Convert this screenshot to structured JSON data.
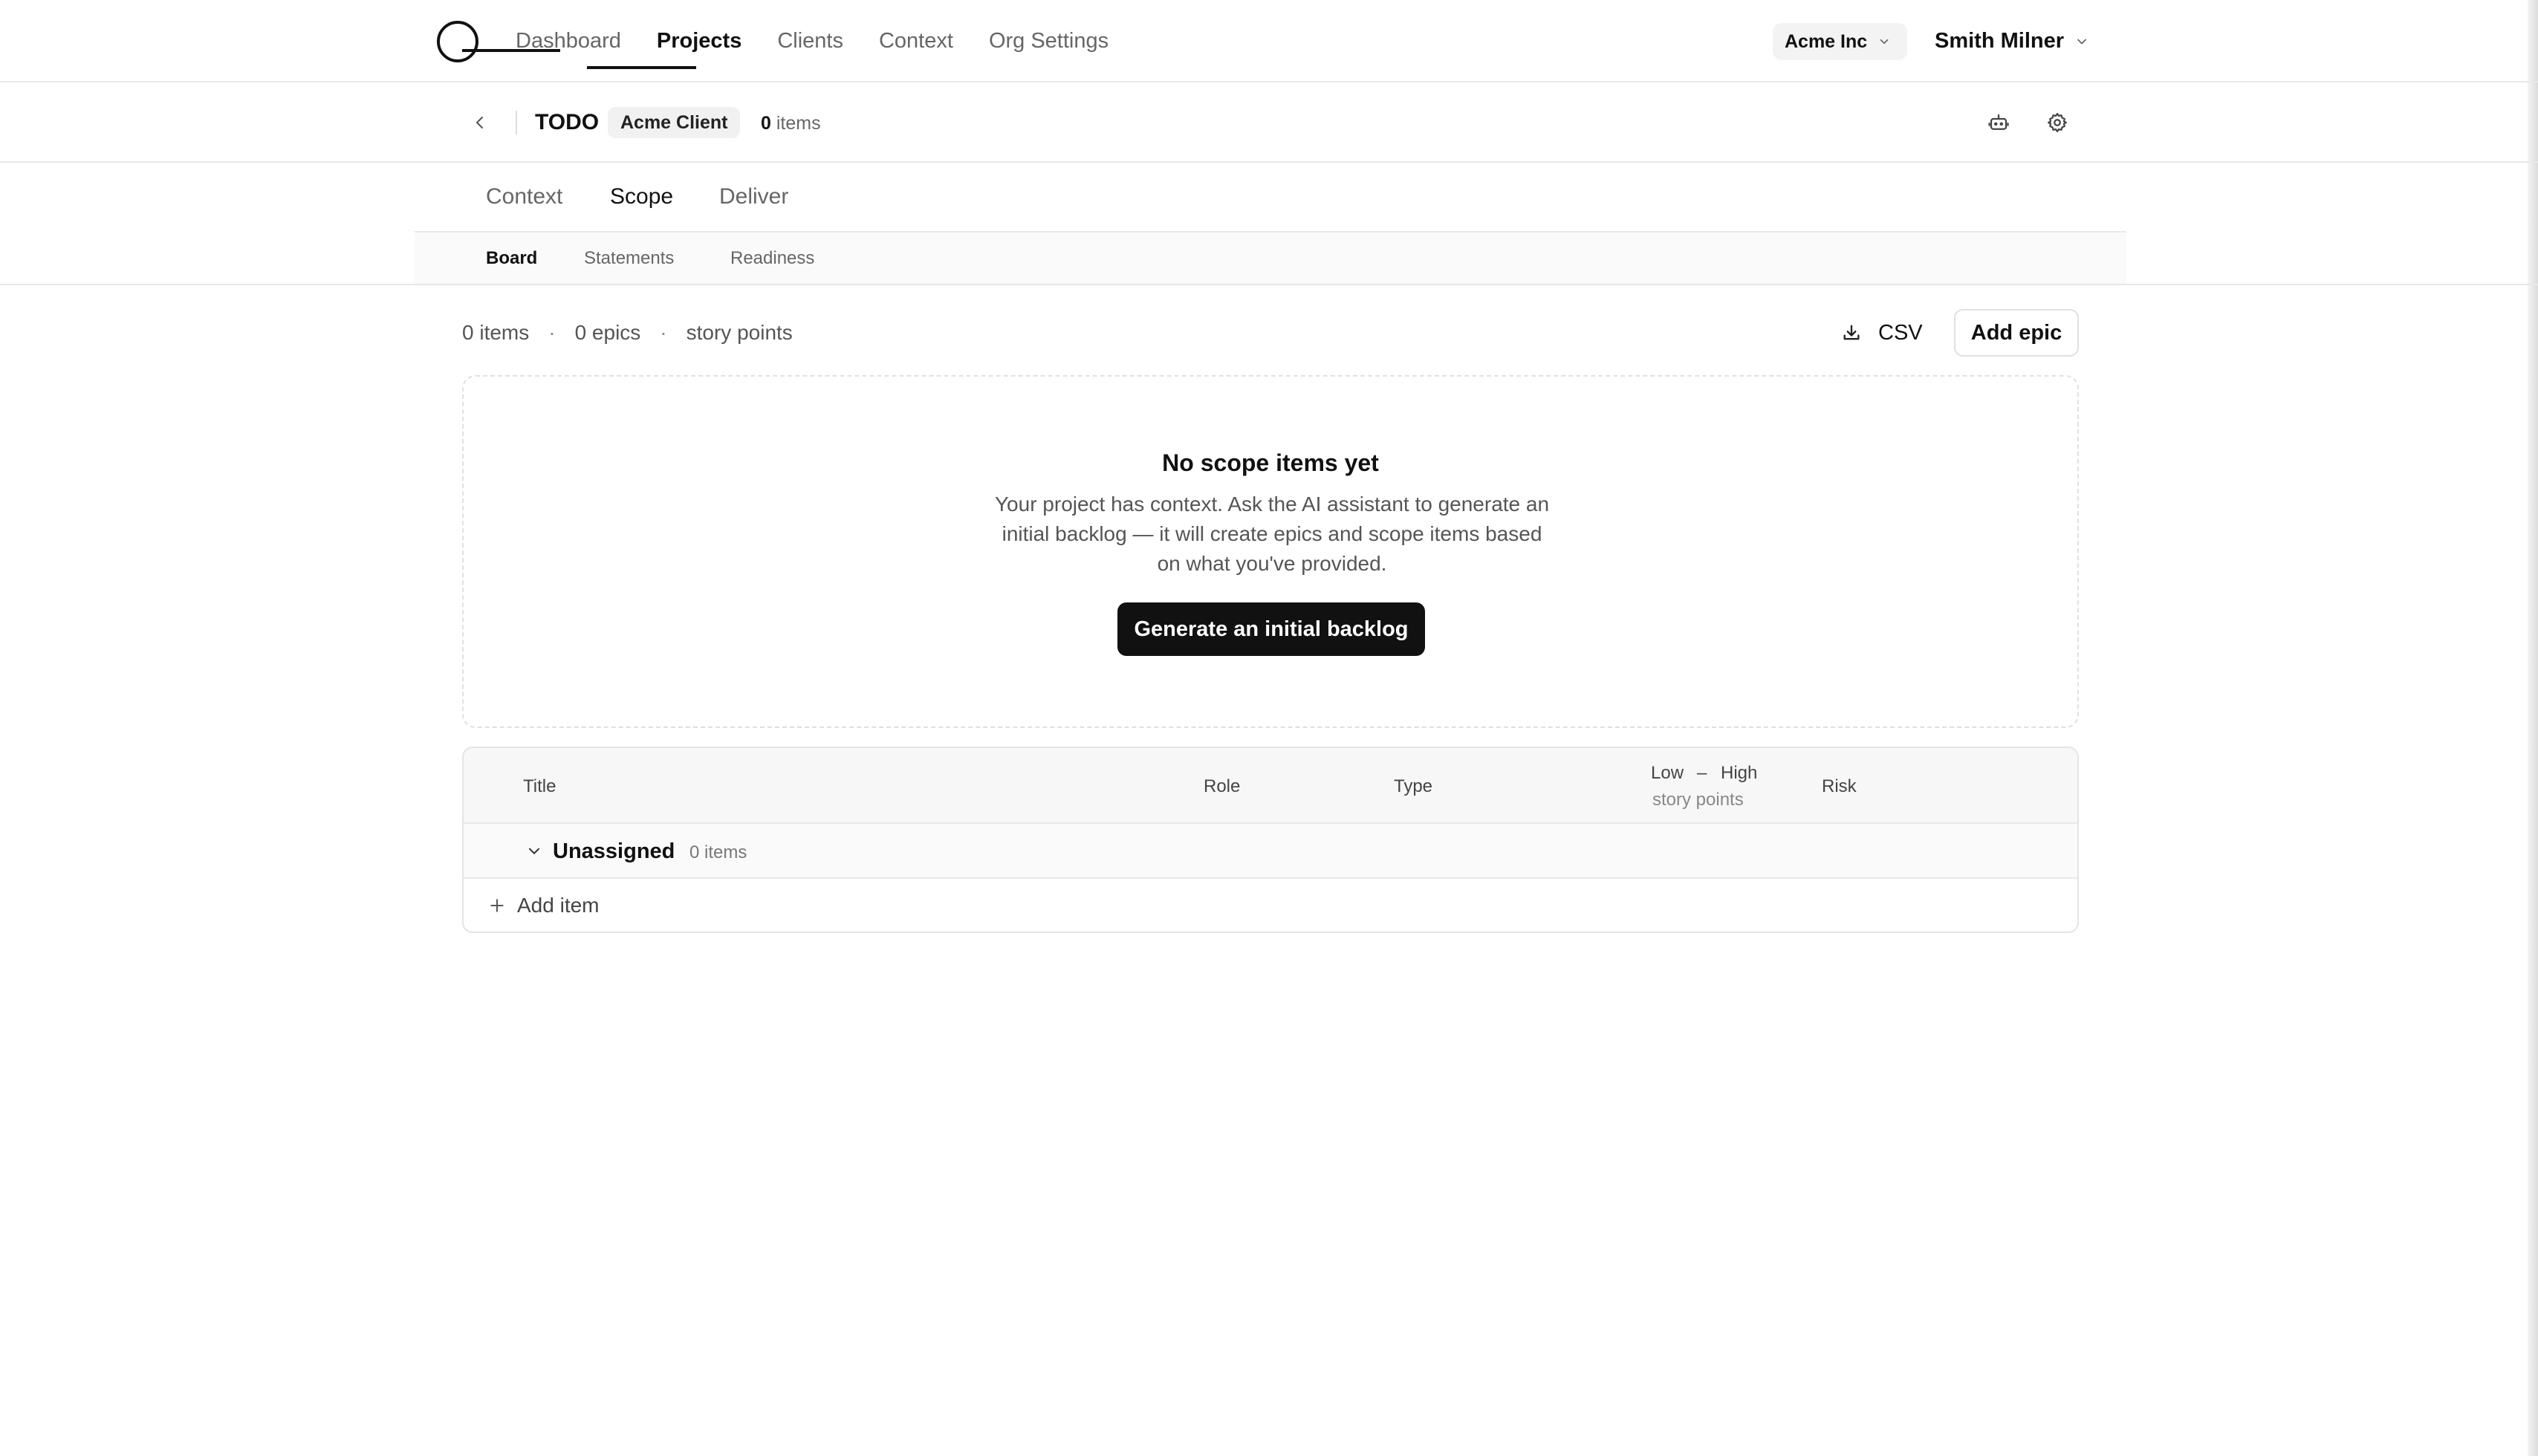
{
  "nav": {
    "items": [
      {
        "label": "Dashboard",
        "active": false
      },
      {
        "label": "Projects",
        "active": true
      },
      {
        "label": "Clients",
        "active": false
      },
      {
        "label": "Context",
        "active": false
      },
      {
        "label": "Org Settings",
        "active": false
      }
    ],
    "org": "Acme Inc",
    "user": "Smith Milner"
  },
  "project": {
    "title": "TODO",
    "client": "Acme Client",
    "item_count": "0",
    "item_count_suffix": "items"
  },
  "tabs": {
    "primary": [
      "Context",
      "Scope",
      "Deliver"
    ],
    "primary_active": "Scope",
    "secondary": [
      "Board",
      "Statements",
      "Readiness"
    ],
    "secondary_active": "Board"
  },
  "summary": {
    "items": "0 items",
    "epics": "0 epics",
    "points": "story points",
    "separator": "·"
  },
  "toolbar": {
    "csv_label": "CSV",
    "add_epic_label": "Add epic"
  },
  "empty_state": {
    "title": "No scope items yet",
    "description": "Your project has context. Ask the AI assistant to generate an initial backlog — it will create epics and scope items based on what you've provided.",
    "button_label": "Generate an initial backlog"
  },
  "table": {
    "columns": {
      "title": "Title",
      "role": "Role",
      "type": "Type",
      "low": "Low",
      "dash": "–",
      "high": "High",
      "points_sub": "story points",
      "risk": "Risk"
    },
    "group": {
      "name": "Unassigned",
      "count": "0 items"
    },
    "add_item_label": "Add item"
  },
  "colors": {
    "primary_button_bg": "#111111",
    "border": "#e4e4e4",
    "muted_text": "#666666"
  }
}
